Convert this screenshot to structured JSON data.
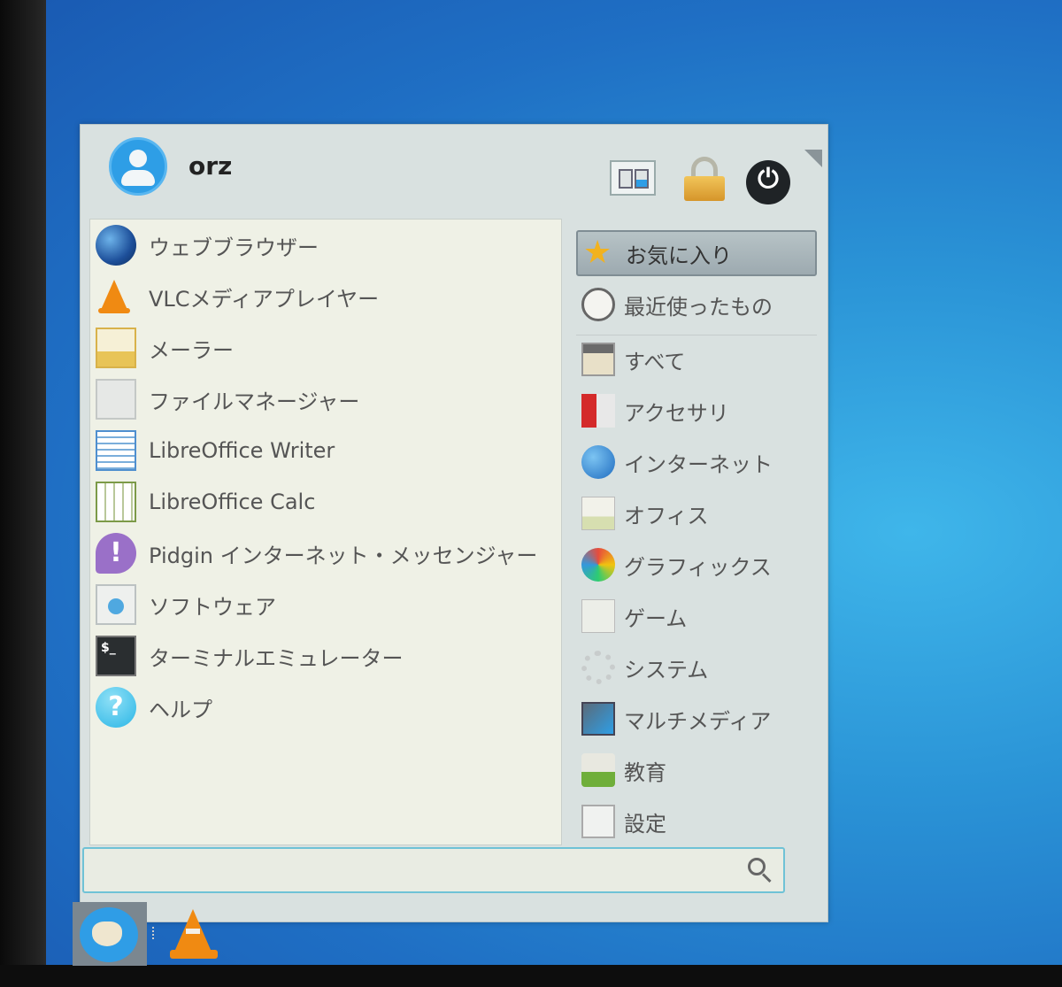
{
  "header": {
    "username": "orz",
    "settings_icon": "settings-manager-icon",
    "lock_icon": "lock-icon",
    "power_icon": "power-icon"
  },
  "favorites": [
    {
      "label": "ウェブブラウザー",
      "icon": "web-browser-icon"
    },
    {
      "label": "VLCメディアプレイヤー",
      "icon": "vlc-icon"
    },
    {
      "label": "メーラー",
      "icon": "mail-icon"
    },
    {
      "label": "ファイルマネージャー",
      "icon": "file-manager-icon"
    },
    {
      "label": "LibreOffice Writer",
      "icon": "writer-icon"
    },
    {
      "label": "LibreOffice Calc",
      "icon": "calc-icon"
    },
    {
      "label": "Pidgin インターネット・メッセンジャー",
      "icon": "pidgin-icon"
    },
    {
      "label": "ソフトウェア",
      "icon": "software-icon"
    },
    {
      "label": "ターミナルエミュレーター",
      "icon": "terminal-icon"
    },
    {
      "label": "ヘルプ",
      "icon": "help-icon"
    }
  ],
  "categories": [
    {
      "label": "お気に入り",
      "icon": "star-icon",
      "selected": true
    },
    {
      "label": "最近使ったもの",
      "icon": "clock-icon"
    },
    {
      "label": "すべて",
      "icon": "all-apps-icon"
    },
    {
      "label": "アクセサリ",
      "icon": "accessories-icon"
    },
    {
      "label": "インターネット",
      "icon": "globe-icon"
    },
    {
      "label": "オフィス",
      "icon": "office-icon"
    },
    {
      "label": "グラフィックス",
      "icon": "graphics-icon"
    },
    {
      "label": "ゲーム",
      "icon": "games-icon"
    },
    {
      "label": "システム",
      "icon": "system-icon"
    },
    {
      "label": "マルチメディア",
      "icon": "multimedia-icon"
    },
    {
      "label": "教育",
      "icon": "education-icon"
    },
    {
      "label": "設定",
      "icon": "settings-icon"
    }
  ],
  "search": {
    "value": "",
    "placeholder": ""
  },
  "terminal_glyph": "$_",
  "help_glyph": "?",
  "pidgin_glyph": "!",
  "power_glyph": "⏻",
  "colors": {
    "accent": "#2e9ee6",
    "selected": "#a9b6bb",
    "panel": "#d9e1e0"
  }
}
